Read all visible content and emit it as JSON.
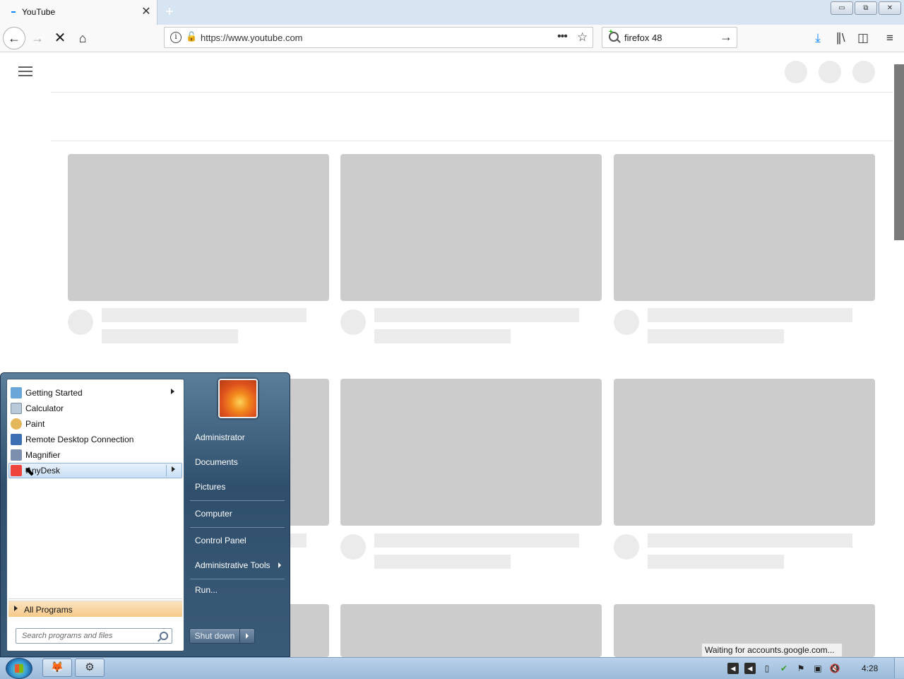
{
  "browser": {
    "tab": {
      "title": "YouTube",
      "close": "✕"
    },
    "new_tab": "+",
    "window_buttons": [
      "▭",
      "⧉",
      "✕"
    ],
    "nav": {
      "back": "←",
      "forward": "→",
      "stop": "✕",
      "home": "⌂"
    },
    "url": "https://www.youtube.com",
    "search": {
      "value": "firefox 48",
      "go": "→"
    },
    "tools": {
      "download": "⤓",
      "library": "∥\\",
      "sidebar": "◫",
      "menu": "≡"
    }
  },
  "status_text": "Waiting for accounts.google.com...",
  "start_menu": {
    "programs": [
      {
        "label": "Getting Started",
        "submenu": true,
        "icon": "getting-started-icon",
        "color": "#6aa6d8"
      },
      {
        "label": "Calculator",
        "submenu": false,
        "icon": "calculator-icon",
        "color": "#b9c9d9"
      },
      {
        "label": "Paint",
        "submenu": false,
        "icon": "paint-icon",
        "color": "#e4b75a"
      },
      {
        "label": "Remote Desktop Connection",
        "submenu": false,
        "icon": "remote-desktop-icon",
        "color": "#3d6fb5"
      },
      {
        "label": "Magnifier",
        "submenu": false,
        "icon": "magnifier-icon",
        "color": "#7d8fae"
      },
      {
        "label": "AnyDesk",
        "submenu": true,
        "icon": "anydesk-icon",
        "color": "#ef443b",
        "highlighted": true
      }
    ],
    "all_programs": "All Programs",
    "search_placeholder": "Search programs and files",
    "right": {
      "user": "Administrator",
      "documents": "Documents",
      "pictures": "Pictures",
      "computer": "Computer",
      "control_panel": "Control Panel",
      "admin_tools": "Administrative Tools",
      "run": "Run..."
    },
    "shutdown": "Shut down"
  },
  "taskbar": {
    "clock": "4:28"
  }
}
